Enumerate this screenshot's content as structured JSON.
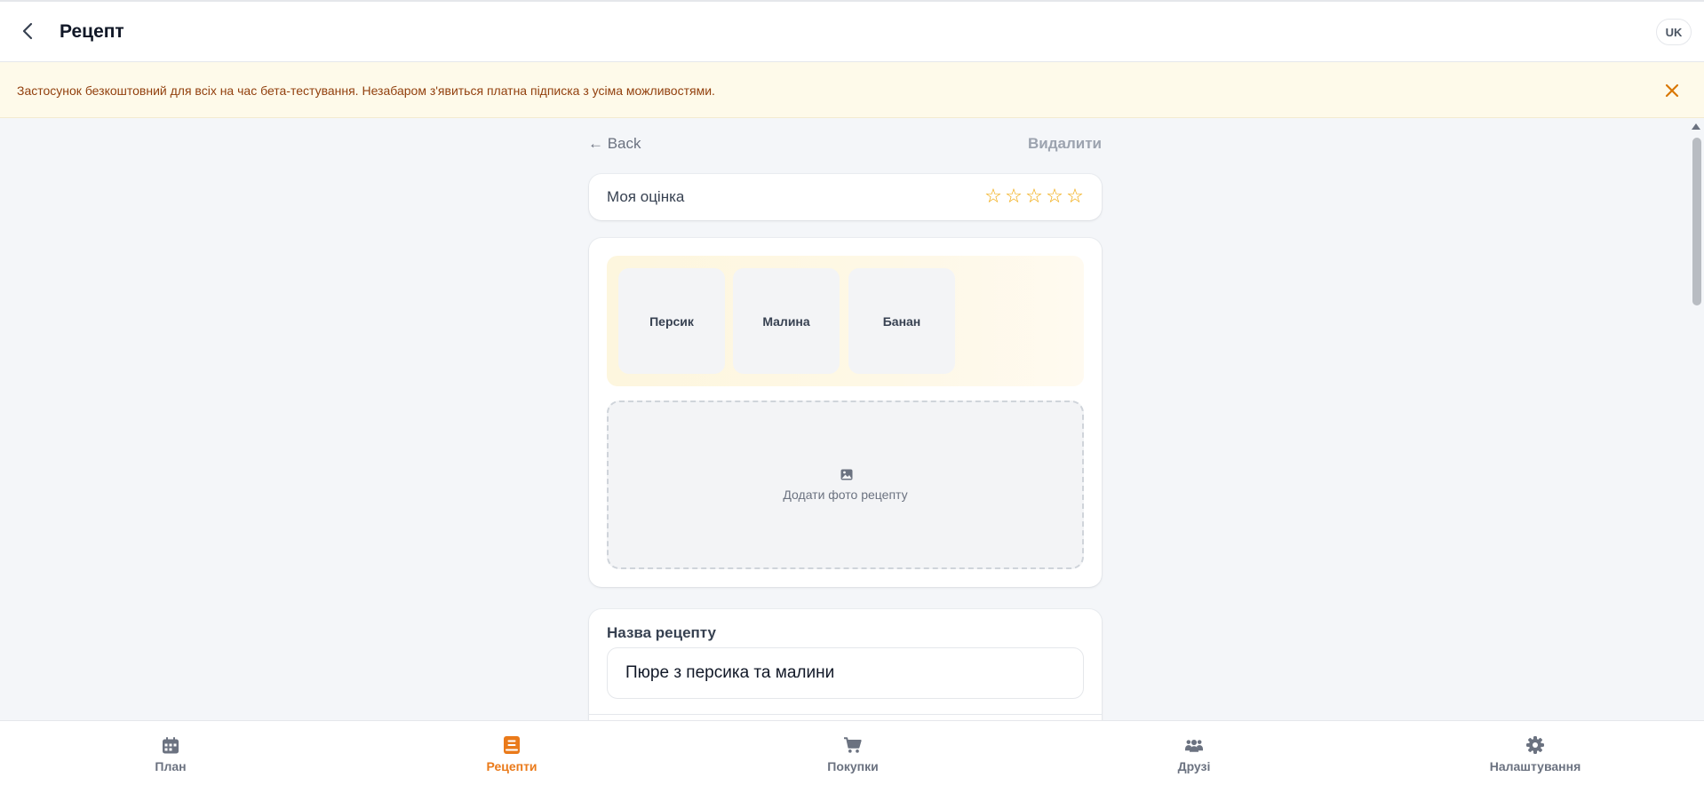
{
  "header": {
    "title": "Рецепт",
    "language": "UK"
  },
  "banner": {
    "text": "Застосунок безкоштовний для всіх на час бета-тестування. Незабаром з'явиться платна підписка з усіма можливостями."
  },
  "actions": {
    "back_label": "← Back",
    "delete_label": "Видалити"
  },
  "rating": {
    "label": "Моя оцінка",
    "stars_total": 5,
    "stars_filled": 0,
    "star_glyph": "☆"
  },
  "ingredients": [
    {
      "name": "Персик"
    },
    {
      "name": "Малина"
    },
    {
      "name": "Банан"
    }
  ],
  "photo": {
    "add_label": "Додати фото рецепту"
  },
  "recipe_name": {
    "label": "Назва рецепту",
    "value": "Пюре з персика та малини"
  },
  "nav": {
    "items": [
      {
        "label": "План",
        "icon": "calendar-icon"
      },
      {
        "label": "Рецепти",
        "icon": "book-icon",
        "active": true
      },
      {
        "label": "Покупки",
        "icon": "cart-icon"
      },
      {
        "label": "Друзі",
        "icon": "users-icon"
      },
      {
        "label": "Налаштування",
        "icon": "gear-icon"
      }
    ]
  },
  "colors": {
    "accent": "#ea7a1a",
    "star": "#f0a500",
    "banner_bg": "#fefaea",
    "banner_text": "#92400e",
    "banner_close": "#d97706"
  }
}
